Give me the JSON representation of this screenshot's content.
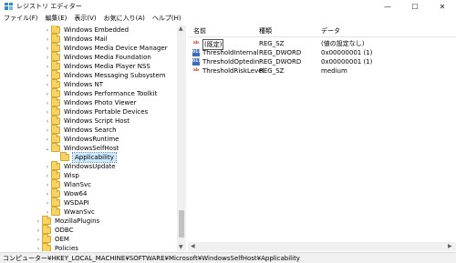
{
  "window": {
    "title": "レジストリ エディター",
    "minimize_glyph": "—",
    "maximize_glyph": "☐",
    "close_glyph": "✕"
  },
  "menu": [
    {
      "label": "ファイル(F)"
    },
    {
      "label": "編集(E)"
    },
    {
      "label": "表示(V)"
    },
    {
      "label": "お気に入り(A)"
    },
    {
      "label": "ヘルプ(H)"
    }
  ],
  "tree": [
    {
      "label": "Windows Embedded",
      "expander": "›",
      "indent": 1
    },
    {
      "label": "Windows Mail",
      "expander": "›",
      "indent": 1
    },
    {
      "label": "Windows Media Device Manager",
      "expander": "›",
      "indent": 1
    },
    {
      "label": "Windows Media Foundation",
      "expander": "›",
      "indent": 1
    },
    {
      "label": "Windows Media Player NSS",
      "expander": "›",
      "indent": 1
    },
    {
      "label": "Windows Messaging Subsystem",
      "expander": "›",
      "indent": 1
    },
    {
      "label": "Windows NT",
      "expander": "›",
      "indent": 1
    },
    {
      "label": "Windows Performance Toolkit",
      "expander": "›",
      "indent": 1
    },
    {
      "label": "Windows Photo Viewer",
      "expander": "›",
      "indent": 1
    },
    {
      "label": "Windows Portable Devices",
      "expander": "›",
      "indent": 1
    },
    {
      "label": "Windows Script Host",
      "expander": "›",
      "indent": 1
    },
    {
      "label": "Windows Search",
      "expander": "›",
      "indent": 1
    },
    {
      "label": "WindowsRuntime",
      "expander": "›",
      "indent": 1
    },
    {
      "label": "WindowsSelfHost",
      "expander": "⌄",
      "indent": 1
    },
    {
      "label": "Applicability",
      "expander": "",
      "indent": 2,
      "selected": true
    },
    {
      "label": "WindowsUpdate",
      "expander": "›",
      "indent": 1
    },
    {
      "label": "Wisp",
      "expander": "›",
      "indent": 1
    },
    {
      "label": "WlanSvc",
      "expander": "›",
      "indent": 1
    },
    {
      "label": "Wow64",
      "expander": "›",
      "indent": 1
    },
    {
      "label": "WSDAPI",
      "expander": "›",
      "indent": 1
    },
    {
      "label": "WwanSvc",
      "expander": "›",
      "indent": 1
    },
    {
      "label": "MozillaPlugins",
      "expander": "›",
      "indent": 0
    },
    {
      "label": "ODBC",
      "expander": "›",
      "indent": 0
    },
    {
      "label": "OEM",
      "expander": "›",
      "indent": 0
    },
    {
      "label": "Policies",
      "expander": "›",
      "indent": 0
    }
  ],
  "list": {
    "columns": {
      "name": "名前",
      "type": "種類",
      "data": "データ"
    },
    "rows": [
      {
        "icon": "ab",
        "icon_kind": "string-value-icon",
        "name": "(既定)",
        "type": "REG_SZ",
        "data": "(値の設定なし)",
        "boxed": true
      },
      {
        "icon": "011",
        "icon_kind": "dword-value-icon",
        "name": "ThresholdInternal",
        "type": "REG_DWORD",
        "data": "0x00000001 (1)",
        "boxed": false
      },
      {
        "icon": "011",
        "icon_kind": "dword-value-icon",
        "name": "ThresholdOptedin",
        "type": "REG_DWORD",
        "data": "0x00000001 (1)",
        "boxed": false
      },
      {
        "icon": "ab",
        "icon_kind": "string-value-icon",
        "name": "ThresholdRiskLevel",
        "type": "REG_SZ",
        "data": "medium",
        "boxed": false
      }
    ]
  },
  "statusbar": {
    "path": "コンピューター¥HKEY_LOCAL_MACHINE¥SOFTWARE¥Microsoft¥WindowsSelfHost¥Applicability"
  },
  "colors": {
    "folder": "#f6d365",
    "selection": "#cce8ff",
    "dword_icon": "#3b6bbf",
    "string_icon": "#c0392b"
  }
}
